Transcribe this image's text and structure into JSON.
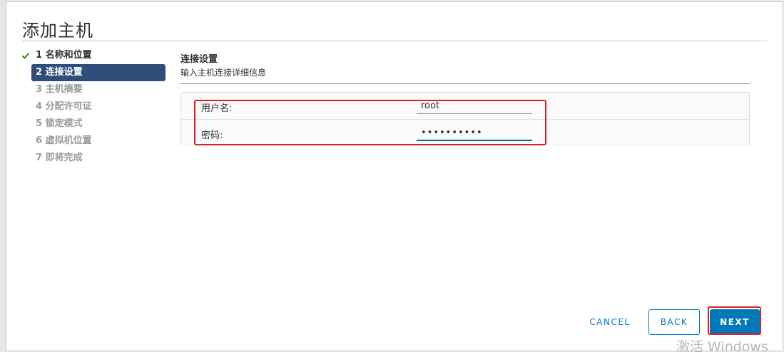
{
  "dialog": {
    "title": "添加主机"
  },
  "steps": [
    {
      "label": "1 名称和位置",
      "state": "done"
    },
    {
      "label": "2 连接设置",
      "state": "active"
    },
    {
      "label": "3 主机摘要",
      "state": "pending"
    },
    {
      "label": "4 分配许可证",
      "state": "pending"
    },
    {
      "label": "5 锁定模式",
      "state": "pending"
    },
    {
      "label": "6 虚拟机位置",
      "state": "pending"
    },
    {
      "label": "7 即将完成",
      "state": "pending"
    }
  ],
  "section": {
    "title": "连接设置",
    "description": "输入主机连接详细信息"
  },
  "form": {
    "username_label": "用户名:",
    "username_value": "root",
    "password_label": "密码:",
    "password_value": "••••••••••"
  },
  "buttons": {
    "cancel": "CANCEL",
    "back": "BACK",
    "next": "NEXT"
  },
  "watermark": "激活 Windows",
  "icons": {
    "step_done": "check-icon"
  },
  "colors": {
    "accent": "#0079b8",
    "active_step": "#2f4e7a",
    "check": "#3c8500",
    "highlight": "#e02020"
  }
}
